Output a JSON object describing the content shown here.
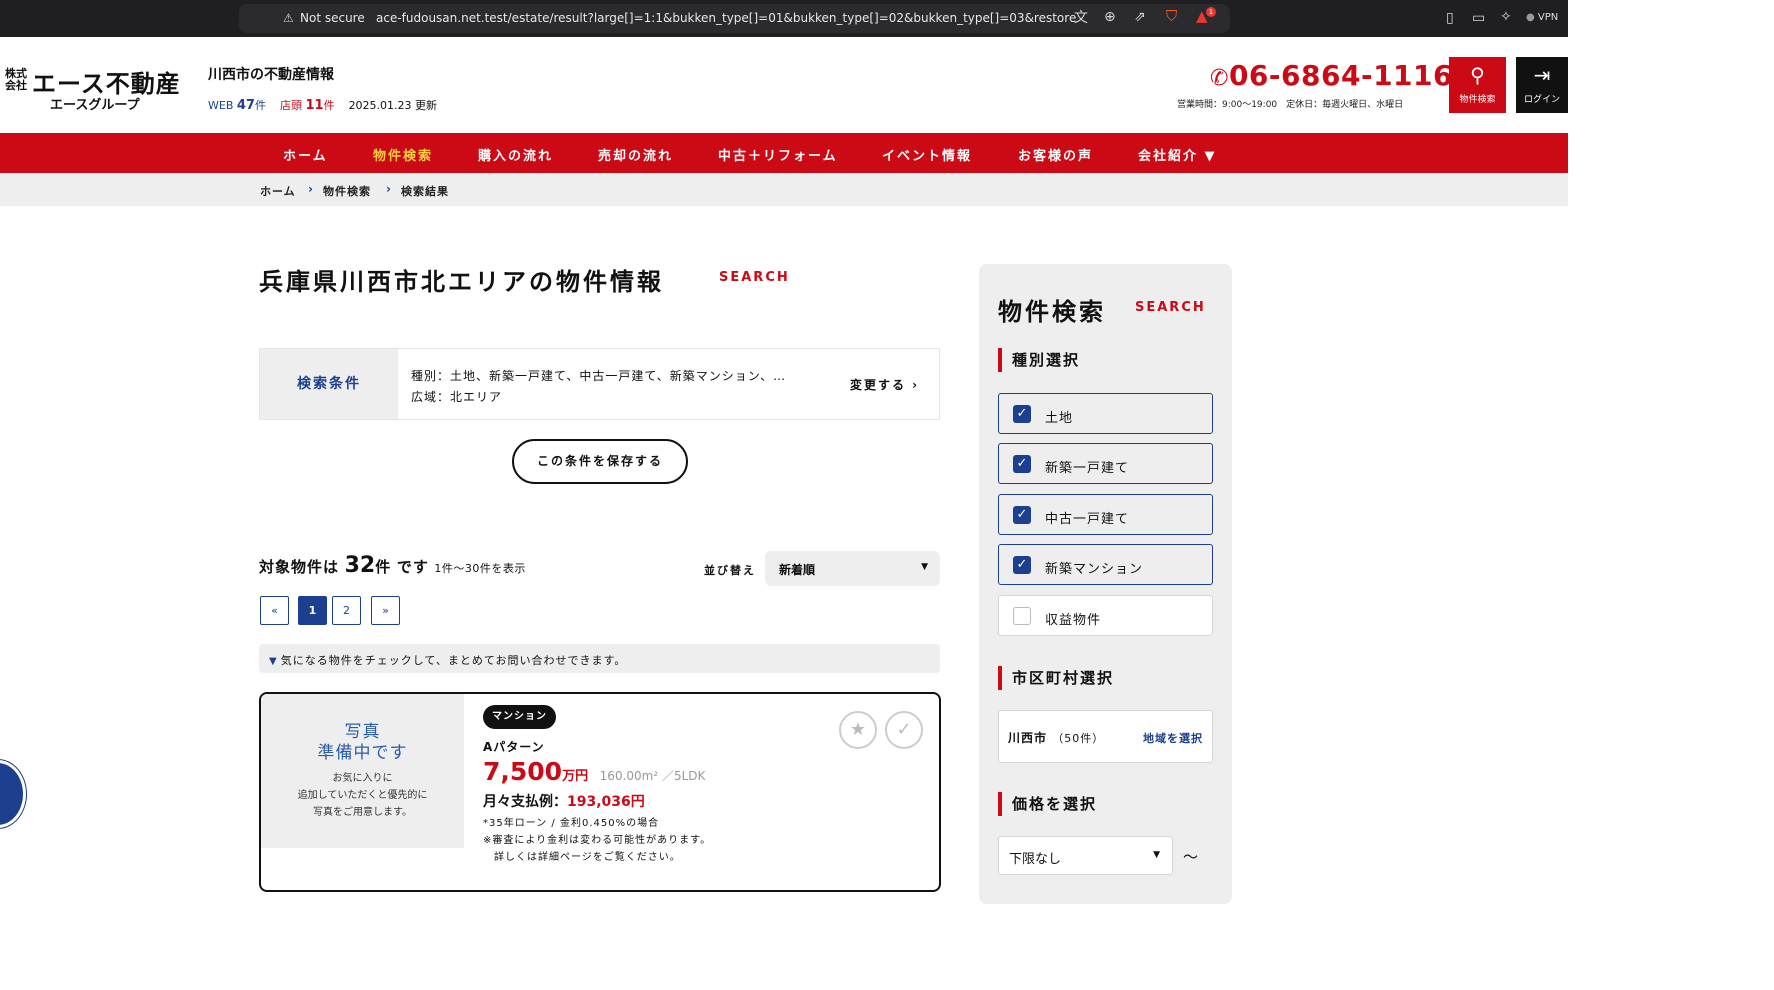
{
  "browser": {
    "security": "Not secure",
    "url": "ace-fudousan.net.test/estate/result?large[]=1:1&bukken_type[]=01&bukken_type[]=02&bukken_type[]=03&restore",
    "notification_count": "1",
    "vpn": "VPN"
  },
  "header": {
    "logo_kabu": "株式会社",
    "logo_main": "エース不動産",
    "logo_sub": "エースグループ",
    "site_title": "川西市の不動産情報",
    "web_label": "WEB",
    "web_count": "47",
    "web_unit": "件",
    "store_label": "店頭",
    "store_count": "11",
    "store_unit": "件",
    "updated": "2025.01.23 更新",
    "phone": "06-6864-1116",
    "hours": "営業時間：9:00〜19:00　定休日：毎週火曜日、水曜日",
    "search_button": "物件検索",
    "login_button": "ログイン"
  },
  "nav": [
    "ホーム",
    "物件検索",
    "購入の流れ",
    "売却の流れ",
    "中古＋リフォーム",
    "イベント情報",
    "お客様の声",
    "会社紹介 ▼"
  ],
  "breadcrumb": [
    "ホーム",
    "物件検索",
    "検索結果"
  ],
  "main": {
    "title": "兵庫県川西市北エリアの物件情報",
    "title_en": "SEARCH",
    "conditions_label": "検索条件",
    "conditions_type": "種別：土地、新築一戸建て、中古一戸建て、新築マンション、…",
    "conditions_area": "広域：北エリア",
    "change_label": "変更する ›",
    "save_label": "この条件を保存する",
    "result_prefix": "対象物件は",
    "result_count": "32",
    "result_unit": "件",
    "result_suffix": "です",
    "result_range": "1件〜30件を表示",
    "sort_label": "並び替え",
    "sort_value": "新着順",
    "pagination": [
      "«",
      "1",
      "2",
      "»"
    ],
    "tip": "気になる物件をチェックして、まとめてお問い合わせできます。"
  },
  "listing": {
    "photo_title_1": "写真",
    "photo_title_2": "準備中です",
    "photo_note_1": "お気に入りに",
    "photo_note_2": "追加していただくと優先的に",
    "photo_note_3": "写真をご用意します。",
    "badge": "マンション",
    "name": "Aパターン",
    "price": "7,500",
    "price_unit": "万円",
    "spec": "160.00m²  ／5LDK",
    "monthly_label": "月々支払例：",
    "monthly_value": "193,036円",
    "loan_note": "*35年ローン / 金利0.450%の場合",
    "disclaimer_1": "※審査により金利は変わる可能性があります。",
    "disclaimer_2": "　詳しくは詳細ページをご覧ください。"
  },
  "sidebar": {
    "title": "物件検索",
    "title_en": "SEARCH",
    "type_section": "種別選択",
    "types": [
      {
        "label": "土地",
        "checked": true
      },
      {
        "label": "新築一戸建て",
        "checked": true
      },
      {
        "label": "中古一戸建て",
        "checked": true
      },
      {
        "label": "新築マンション",
        "checked": true
      },
      {
        "label": "収益物件",
        "checked": false
      }
    ],
    "city_section": "市区町村選択",
    "city_name": "川西市",
    "city_count": "（50件）",
    "city_select": "地域を選択",
    "price_section": "価格を選択",
    "price_min": "下限なし",
    "tilde": "〜"
  },
  "colors": {
    "brand_red": "#cc0a16",
    "brand_blue": "#1d3f8f",
    "nav_active": "#ffcf3f"
  }
}
